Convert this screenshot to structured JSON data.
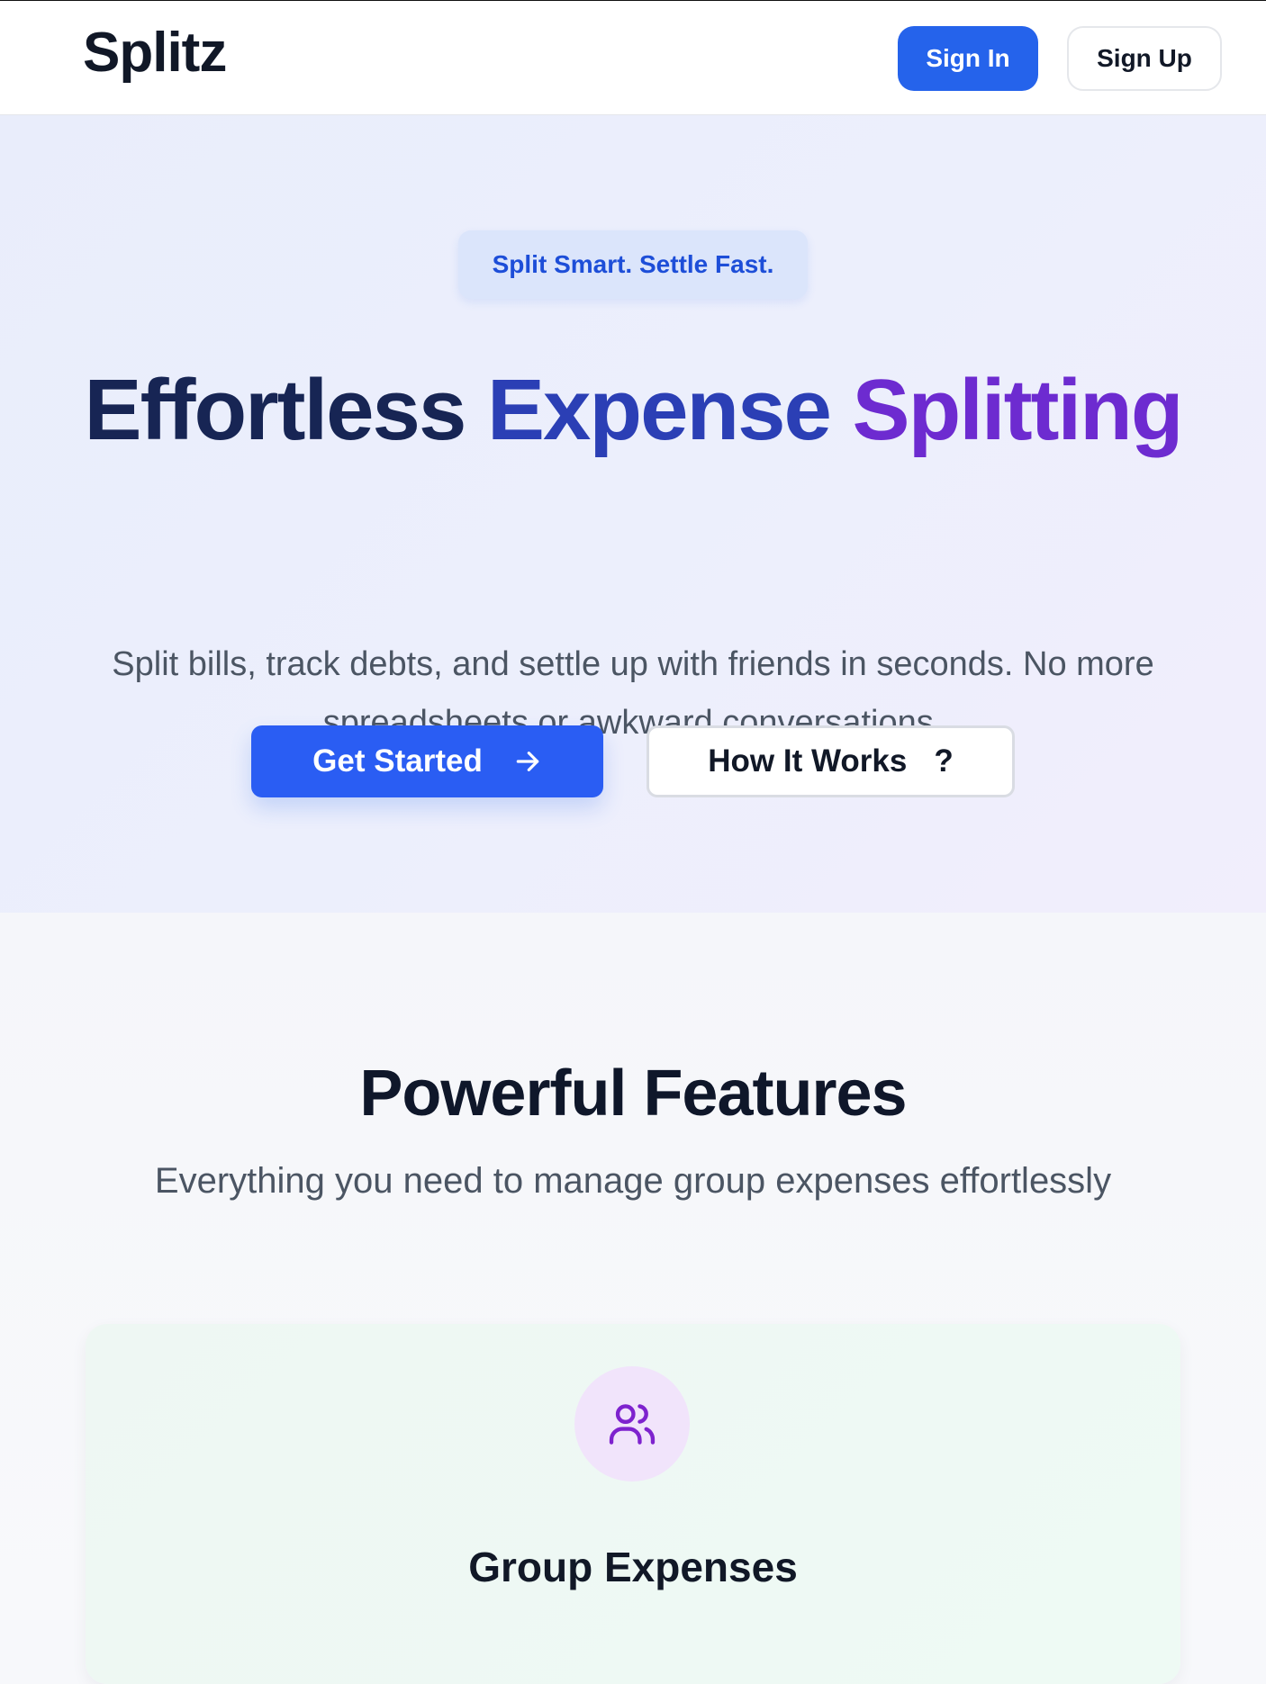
{
  "header": {
    "logo": "Splitz",
    "sign_in": "Sign In",
    "sign_up": "Sign Up"
  },
  "hero": {
    "tagline": "Split Smart. Settle Fast.",
    "headline_word1": "Effortless",
    "headline_word2": "Expense",
    "headline_word3": "Splitting",
    "subtitle": "Split bills, track debts, and settle up with friends in seconds. No more spreadsheets or awkward conversations.",
    "primary_cta": "Get Started",
    "primary_cta_icon": "arrow-right-icon",
    "secondary_cta": "How It Works",
    "secondary_cta_icon": "question-mark-icon"
  },
  "features": {
    "title": "Powerful Features",
    "subtitle": "Everything you need to manage group expenses effortlessly",
    "cards": [
      {
        "icon": "users-icon",
        "title": "Group Expenses"
      }
    ]
  },
  "colors": {
    "brand_blue": "#2563eb",
    "headline_dark": "#172554",
    "headline_blue": "#2b3fb5",
    "headline_purple": "#6d2bd0",
    "icon_purple": "#7e22ce"
  }
}
